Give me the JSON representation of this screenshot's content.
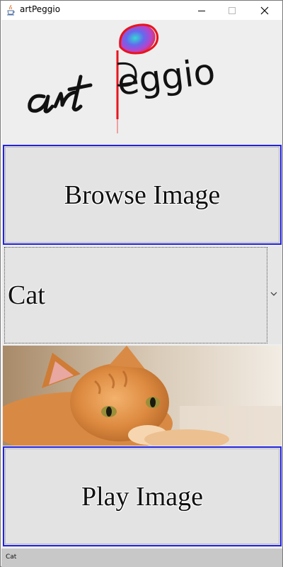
{
  "window": {
    "title": "artPeggio",
    "icon": "java-cup-icon"
  },
  "logo": {
    "script_part": "art",
    "text_part": "eggio",
    "colors": {
      "red": "#e8141e",
      "blue": "#4a5ff0",
      "cyan": "#29d5d0",
      "purple": "#b83cc8"
    }
  },
  "buttons": {
    "browse_label": "Browse Image",
    "play_label": "Play Image"
  },
  "combo": {
    "selected": "Cat"
  },
  "image": {
    "subject": "orange-tabby-cat"
  },
  "status": {
    "text": "Cat"
  },
  "colors": {
    "button_border": "#2222dd",
    "button_bg": "#e3e3e3",
    "panel_bg": "#eeeeee",
    "status_bg": "#c8c8c8"
  }
}
